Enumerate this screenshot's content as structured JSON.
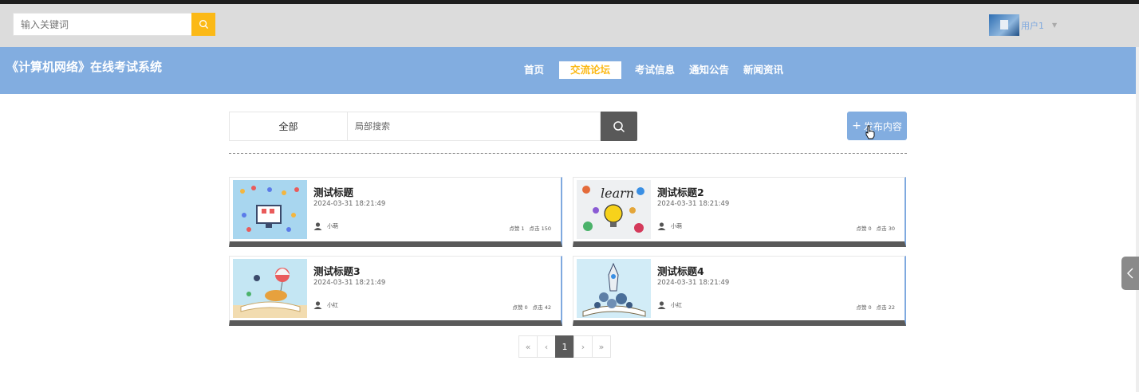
{
  "top": {
    "search_placeholder": "输入关键词",
    "username": "用户1"
  },
  "header": {
    "site_title": "《计算机网络》在线考试系统",
    "nav": [
      "首页",
      "交流论坛",
      "考试信息",
      "通知公告",
      "新闻资讯"
    ],
    "active_nav": "交流论坛"
  },
  "filter": {
    "category": "全部",
    "search_placeholder": "局部搜索",
    "publish_label": "发布内容"
  },
  "posts": [
    {
      "title": "测试标题",
      "date": "2024-03-31 18:21:49",
      "author": "小萌",
      "likes": "点赞 1",
      "clicks": "点击 150",
      "thumb_icon": "computer-illustration"
    },
    {
      "title": "测试标题2",
      "date": "2024-03-31 18:21:49",
      "author": "小萌",
      "likes": "点赞 0",
      "clicks": "点击 30",
      "thumb_icon": "learn-lightbulb"
    },
    {
      "title": "测试标题3",
      "date": "2024-03-31 18:21:49",
      "author": "小红",
      "likes": "点赞 0",
      "clicks": "点击 42",
      "thumb_icon": "open-book-balloon"
    },
    {
      "title": "测试标题4",
      "date": "2024-03-31 18:21:49",
      "author": "小红",
      "likes": "点赞 0",
      "clicks": "点击 22",
      "thumb_icon": "book-rocket"
    }
  ],
  "pagination": {
    "first": "«",
    "prev": "‹",
    "current": "1",
    "next": "›",
    "last": "»"
  },
  "colors": {
    "accent_blue": "#82ade0",
    "accent_yellow": "#fbb917",
    "dark_gray": "#5a5a5a"
  }
}
